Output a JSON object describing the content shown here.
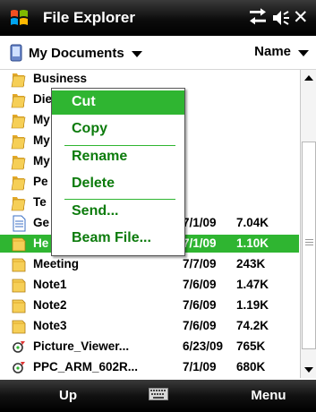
{
  "title_bar": {
    "app_title": "File Explorer",
    "icons": [
      "windows-start-icon",
      "connectivity-icon",
      "volume-icon",
      "close-icon"
    ],
    "close_glyph": "✕"
  },
  "nav": {
    "folder_label": "My Documents",
    "sort_label": "Name"
  },
  "files": [
    {
      "name": "Business",
      "date": "",
      "size": "",
      "icon": "folder"
    },
    {
      "name": "Die",
      "date": "",
      "size": "",
      "icon": "folder"
    },
    {
      "name": "My",
      "date": "",
      "size": "",
      "icon": "folder"
    },
    {
      "name": "My",
      "date": "",
      "size": "",
      "icon": "folder"
    },
    {
      "name": "My",
      "date": "",
      "size": "",
      "icon": "folder"
    },
    {
      "name": "Pe",
      "date": "",
      "size": "",
      "icon": "folder"
    },
    {
      "name": "Te",
      "date": "",
      "size": "",
      "icon": "folder"
    },
    {
      "name": "Ge",
      "date": "7/1/09",
      "size": "7.04K",
      "icon": "document"
    },
    {
      "name": "He",
      "date": "7/1/09",
      "size": "1.10K",
      "icon": "note",
      "selected": true
    },
    {
      "name": "Meeting",
      "date": "7/7/09",
      "size": "243K",
      "icon": "note"
    },
    {
      "name": "Note1",
      "date": "7/6/09",
      "size": "1.47K",
      "icon": "note"
    },
    {
      "name": "Note2",
      "date": "7/6/09",
      "size": "1.19K",
      "icon": "note"
    },
    {
      "name": "Note3",
      "date": "7/6/09",
      "size": "74.2K",
      "icon": "note"
    },
    {
      "name": "Picture_Viewer...",
      "date": "6/23/09",
      "size": "765K",
      "icon": "program"
    },
    {
      "name": "PPC_ARM_602R...",
      "date": "7/1/09",
      "size": "680K",
      "icon": "program"
    }
  ],
  "context_menu": {
    "items": [
      {
        "label": "Cut",
        "highlighted": true
      },
      {
        "label": "Copy"
      },
      {
        "label": "Rename"
      },
      {
        "label": "Delete"
      },
      {
        "label": "Send..."
      },
      {
        "label": "Beam File..."
      }
    ]
  },
  "softkeys": {
    "left": "Up",
    "right": "Menu"
  },
  "colors": {
    "accent_green": "#2fb531",
    "menu_text_green": "#0c7b0c",
    "folder_yellow": "#f2c244"
  }
}
